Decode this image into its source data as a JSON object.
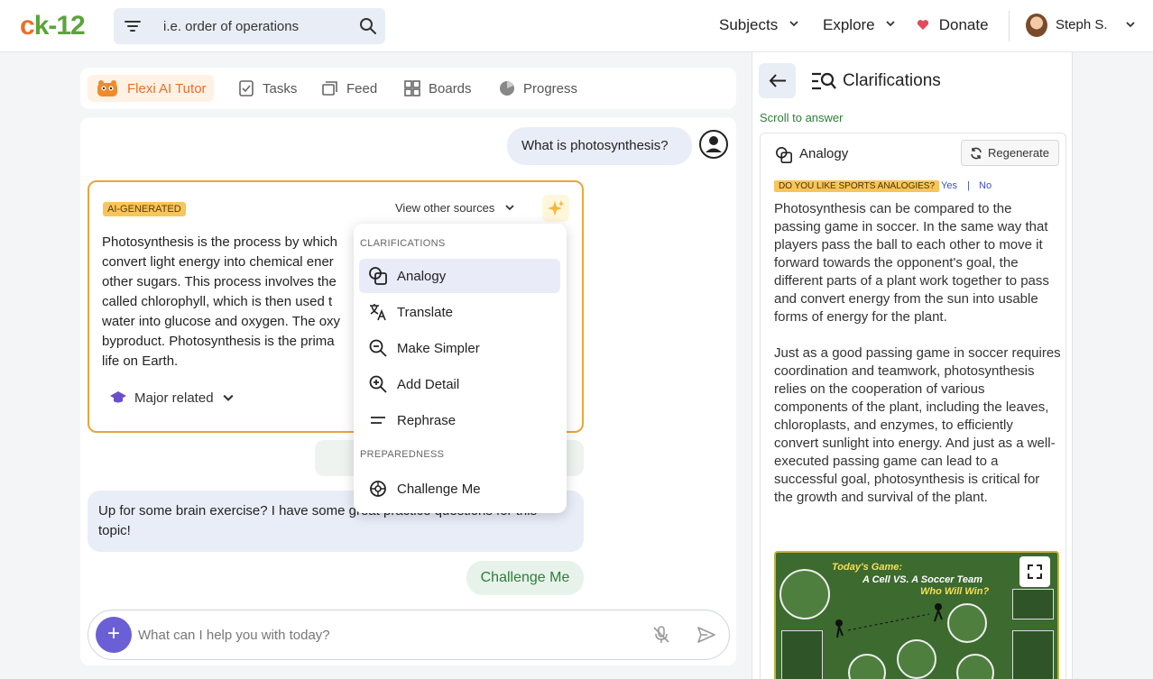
{
  "header": {
    "logo_c": "c",
    "logo_k": "k-12",
    "search_placeholder": "i.e. order of operations",
    "nav": {
      "subjects": "Subjects",
      "explore": "Explore",
      "donate": "Donate"
    },
    "user_name": "Steph S."
  },
  "tabs": [
    {
      "label": "Flexi AI Tutor",
      "icon": "flexi-mascot-icon",
      "active": true
    },
    {
      "label": "Tasks",
      "icon": "tasks-icon"
    },
    {
      "label": "Feed",
      "icon": "feed-icon"
    },
    {
      "label": "Boards",
      "icon": "boards-icon"
    },
    {
      "label": "Progress",
      "icon": "progress-icon"
    }
  ],
  "chat": {
    "question": "What is photosynthesis?",
    "ai_badge": "AI-GENERATED",
    "view_other_sources": "View other sources",
    "answer_lines": [
      "Photosynthesis is the process by which",
      "convert light energy into chemical ener",
      "other sugars. This process involves the",
      "called chlorophyll, which is then used t",
      "water into glucose and oxygen. The oxy",
      "byproduct. Photosynthesis is the prima",
      "life on Earth."
    ],
    "major_related": "Major related",
    "brain_exercise": "Up for some brain exercise? I have some great practice questions for this topic!",
    "challenge_me": "Challenge Me",
    "composer_placeholder": "What can I help you with today?"
  },
  "dropdown": {
    "clarifications_head": "CLARIFICATIONS",
    "items": [
      {
        "label": "Analogy",
        "icon": "analogy-icon",
        "selected": true
      },
      {
        "label": "Translate",
        "icon": "translate-icon"
      },
      {
        "label": "Make Simpler",
        "icon": "zoom-out-icon"
      },
      {
        "label": "Add Detail",
        "icon": "zoom-in-icon"
      },
      {
        "label": "Rephrase",
        "icon": "rephrase-icon"
      }
    ],
    "preparedness_head": "PREPAREDNESS",
    "challenge_item": "Challenge Me"
  },
  "panel": {
    "title": "Clarifications",
    "scroll_to_answer": "Scroll to answer",
    "analogy_title": "Analogy",
    "regenerate": "Regenerate",
    "sports_question": "DO YOU LIKE SPORTS ANALOGIES?",
    "yes": "Yes",
    "separator": "|",
    "no": "No",
    "paragraph1": "Photosynthesis can be compared to the passing game in soccer. In the same way that players pass the ball to each other to move it forward towards the opponent's goal, the different parts of a plant work together to pass and convert energy from the sun into usable forms of energy for the plant.",
    "paragraph2": "Just as a good passing game in soccer requires coordination and teamwork, photosynthesis relies on the cooperation of various components of the plant, including the leaves, chloroplasts, and enzymes, to efficiently convert sunlight into energy. And just as a well-executed passing game can lead to a successful goal, photosynthesis is critical for the growth and survival of the plant.",
    "poster": {
      "line1": "Today's Game:",
      "line2": "A Cell VS. A Soccer Team",
      "line3": "Who Will Win?"
    }
  },
  "colors": {
    "accent_orange": "#e8702a",
    "logo_green": "#5aa43a",
    "answer_border": "#e8a63a",
    "composer_plus": "#6b5fd6",
    "panel_green": "#2e7d3a"
  }
}
